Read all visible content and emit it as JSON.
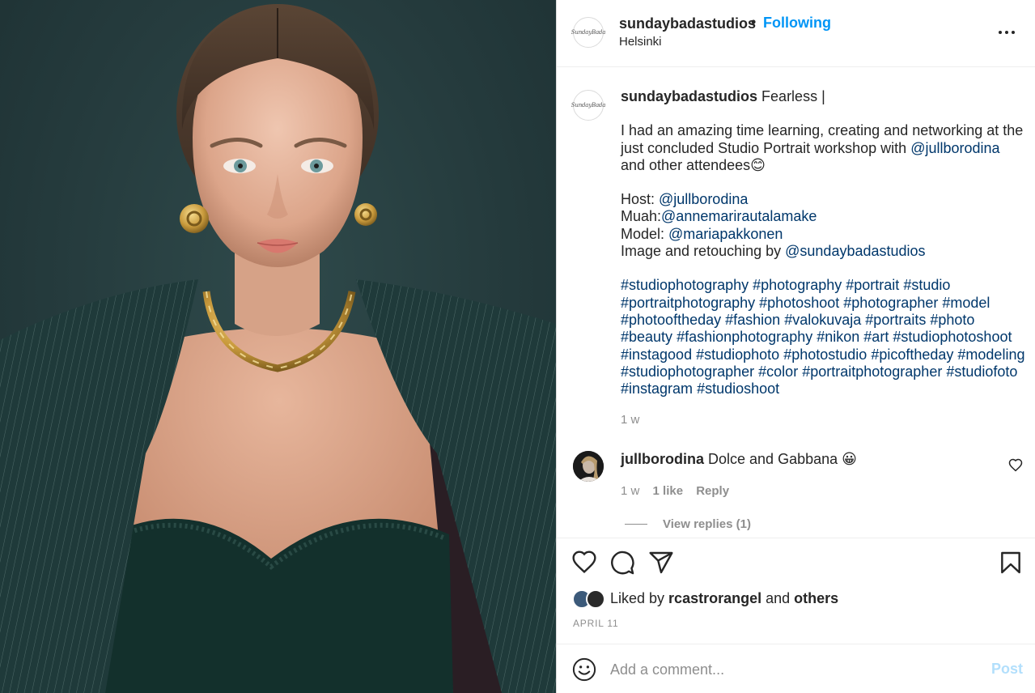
{
  "post": {
    "username": "sundaybadastudios",
    "dot": "•",
    "follow_status": "Following",
    "location": "Helsinki",
    "avatar_text": "SundayBada"
  },
  "caption": {
    "username": "sundaybadastudios",
    "title": "Fearless |",
    "line1": "I had an amazing time learning, creating and networking at the just concluded Studio Portrait workshop with ",
    "line1_mention": "@jullborodina",
    "line1_tail": " and other attendees😊",
    "host_label": "Host: ",
    "host": "@jullborodina",
    "muah_label": "Muah:",
    "muah": "@annemarirautalamake",
    "model_label": "Model: ",
    "model": "@mariapakkonen",
    "image_label": "Image and retouching by ",
    "image": "@sundaybadastudios",
    "hashtags": [
      "#studiophotography",
      "#photography",
      "#portrait",
      "#studio",
      "#portraitphotography",
      "#photoshoot",
      "#photographer",
      "#model",
      "#photooftheday",
      "#fashion",
      "#valokuvaja",
      "#portraits",
      "#photo",
      "#beauty",
      "#fashionphotography",
      "#nikon",
      "#art",
      "#studiophotoshoot",
      "#instagood",
      "#studiophoto",
      "#photostudio",
      "#picoftheday",
      "#modeling",
      "#studiophotographer",
      "#color",
      "#portraitphotographer",
      "#studiofoto",
      "#instagram",
      "#studioshoot"
    ],
    "time": "1 w"
  },
  "comment": {
    "username": "jullborodina",
    "text": "Dolce and Gabbana 😀",
    "time": "1 w",
    "likes": "1 like",
    "reply": "Reply",
    "view_replies": "View replies (1)"
  },
  "likes": {
    "prefix": "Liked by ",
    "user": "rcastrorangel",
    "middle": " and ",
    "others": "others"
  },
  "date": "APRIL 11",
  "comment_box": {
    "placeholder": "Add a comment...",
    "post_label": "Post"
  },
  "icons": {
    "more": "more-options-icon",
    "like": "heart-icon",
    "comment": "comment-icon",
    "share": "share-icon",
    "save": "bookmark-icon",
    "emoji": "emoji-icon"
  },
  "colors": {
    "link_blue": "#00376b",
    "follow_blue": "#0095f6",
    "post_disabled": "#b2dffc",
    "muted": "#8e8e8e",
    "background_teal": "#2a4143"
  }
}
